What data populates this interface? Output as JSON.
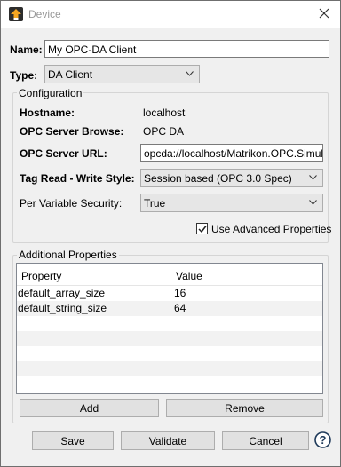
{
  "window": {
    "title": "Device",
    "app_icon": "upload-arrow-icon",
    "close_icon": "close-icon"
  },
  "name_field": {
    "label": "Name:",
    "value": "My OPC-DA Client"
  },
  "type_field": {
    "label": "Type:",
    "value": "DA Client"
  },
  "configuration": {
    "title": "Configuration",
    "hostname_label": "Hostname:",
    "hostname_value": "localhost",
    "browse_label": "OPC Server Browse:",
    "browse_value": "OPC DA",
    "url_label": "OPC Server URL:",
    "url_value": "opcda://localhost/Matrikon.OPC.Simul",
    "tag_style_label": "Tag Read - Write Style:",
    "tag_style_value": "Session based (OPC 3.0 Spec)",
    "security_label": "Per Variable Security:",
    "security_value": "True",
    "advanced_label": "Use Advanced Properties",
    "advanced_checked": true
  },
  "additional": {
    "title": "Additional Properties",
    "columns": [
      "Property",
      "Value"
    ],
    "rows": [
      {
        "property": "default_array_size",
        "value": "16"
      },
      {
        "property": "default_string_size",
        "value": "64"
      }
    ],
    "add_label": "Add",
    "remove_label": "Remove"
  },
  "footer": {
    "save_label": "Save",
    "validate_label": "Validate",
    "cancel_label": "Cancel",
    "help_icon": "help-icon"
  },
  "colors": {
    "border": "#adadad",
    "button_bg": "#e1e1e1",
    "combo_bg": "#e6e6e6",
    "dialog_bg": "#f0f0f0"
  }
}
